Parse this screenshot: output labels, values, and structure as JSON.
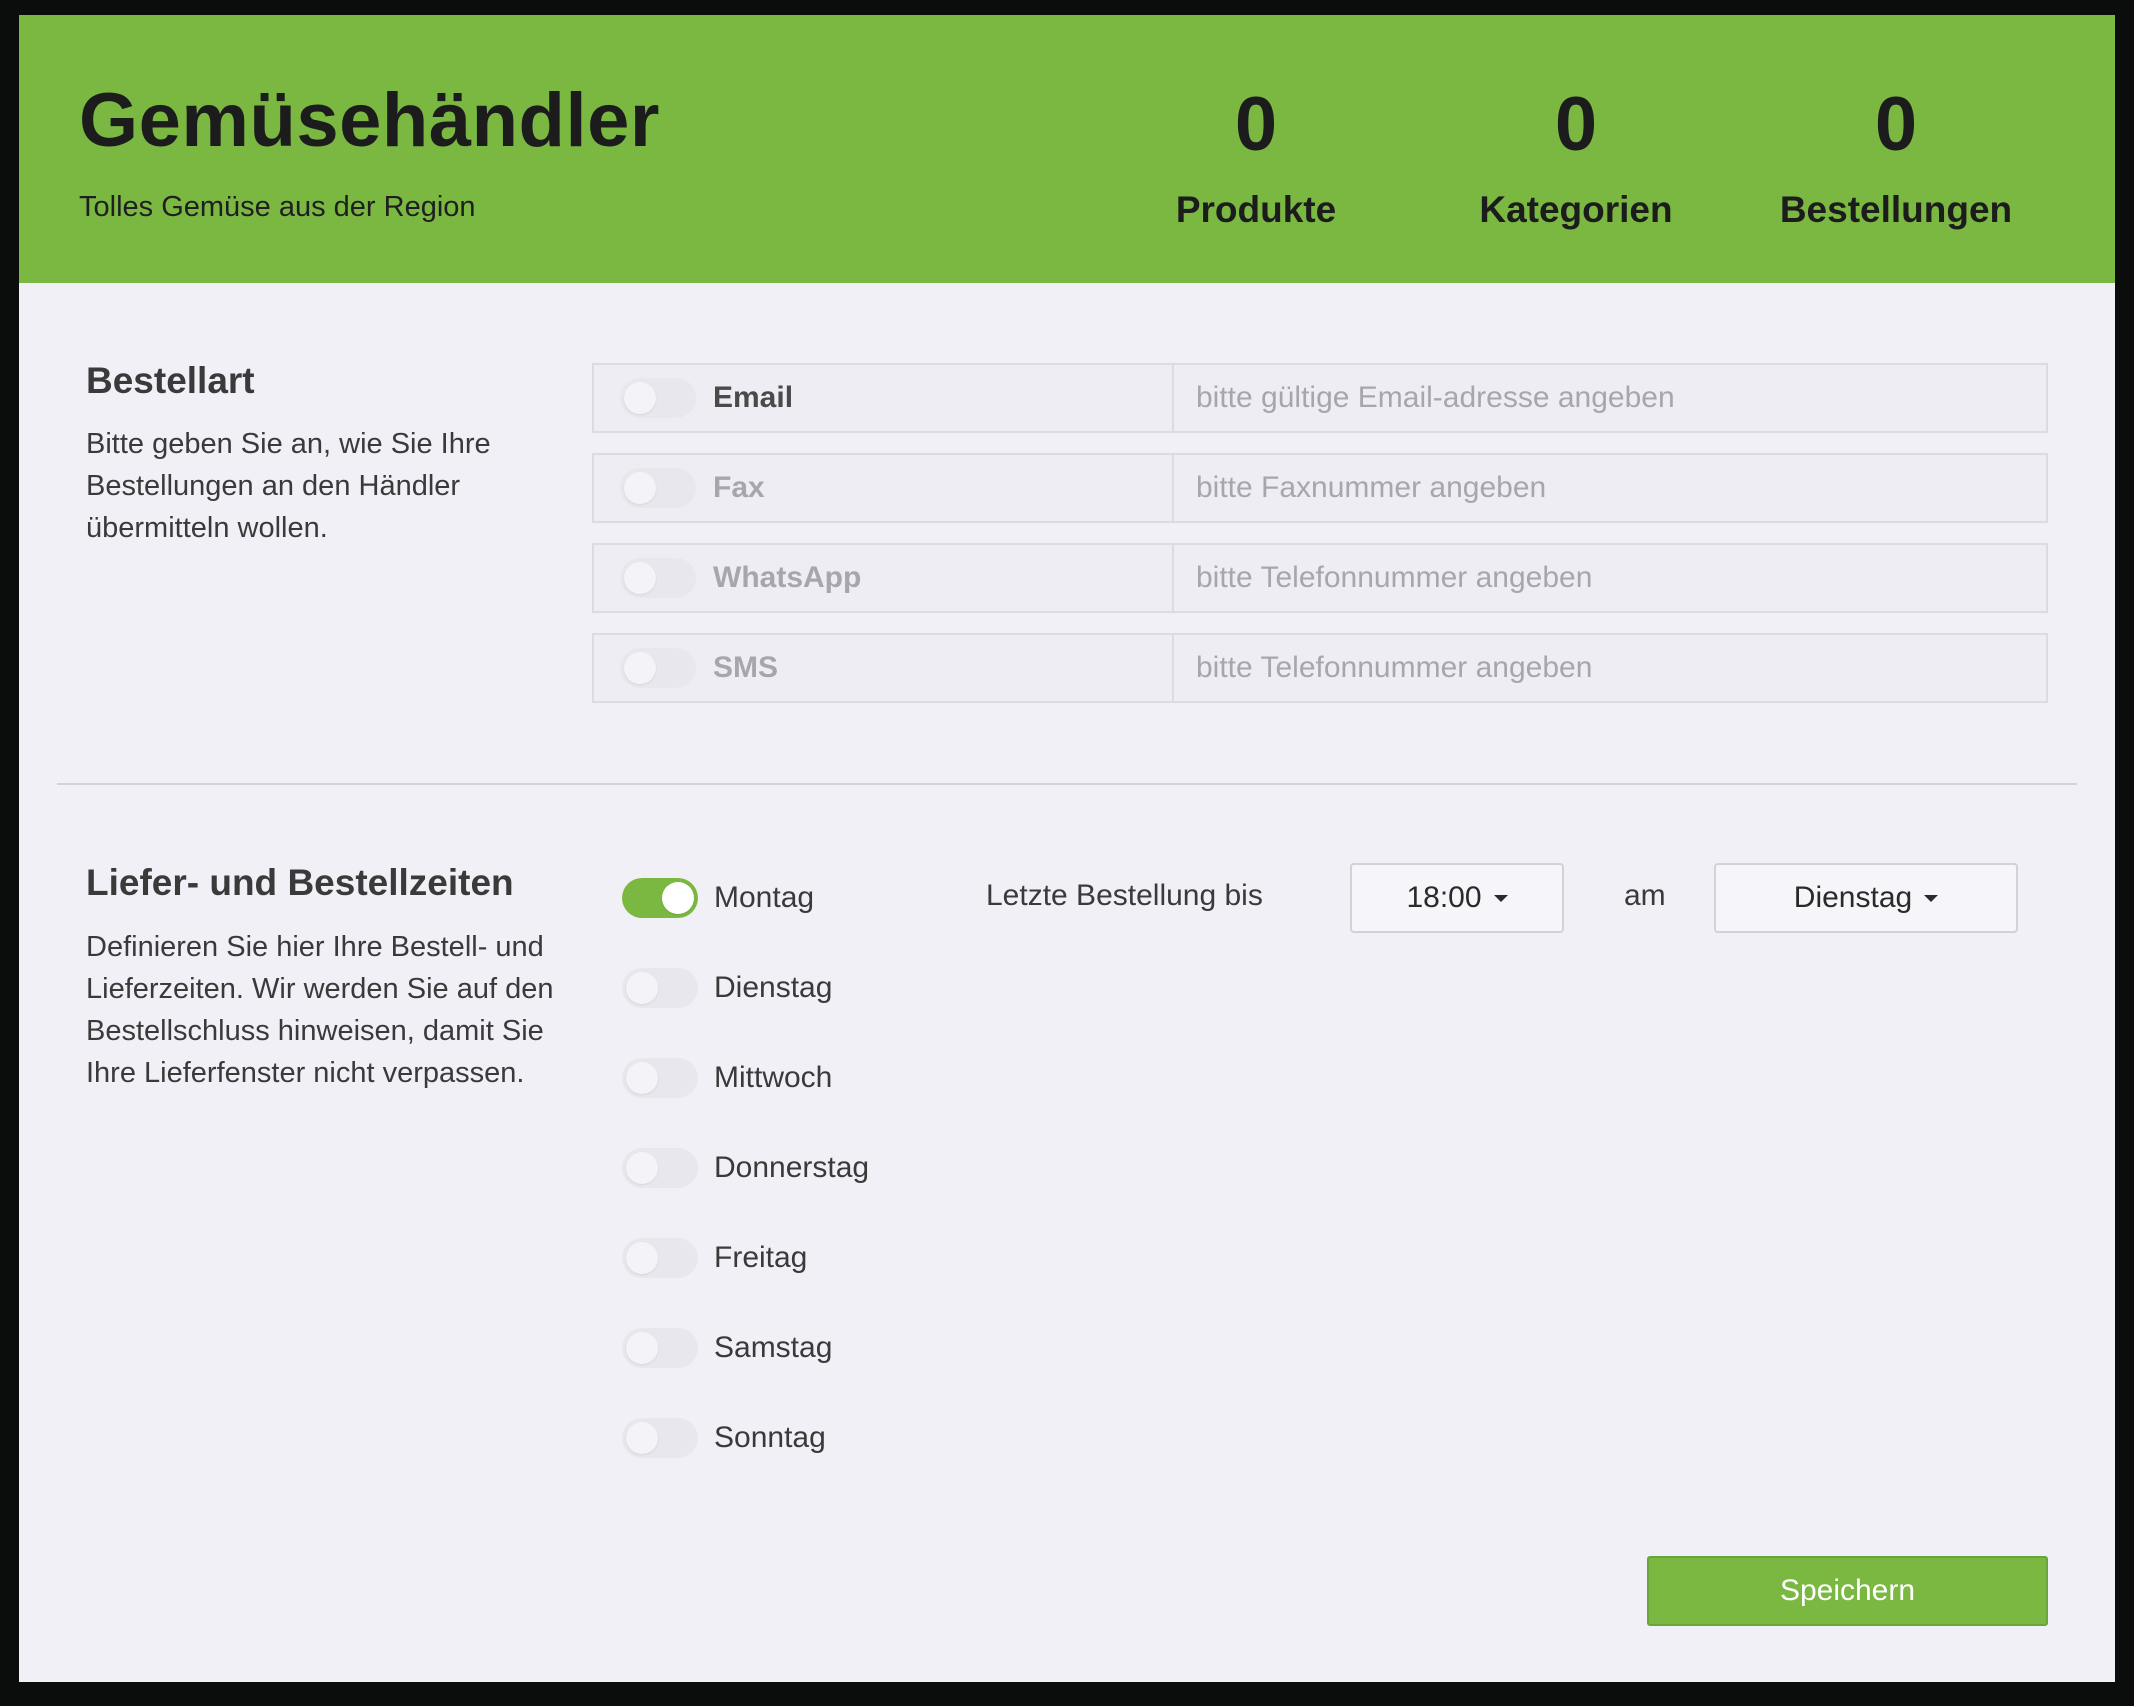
{
  "header": {
    "title": "Gemüsehändler",
    "subtitle": "Tolles Gemüse aus der Region",
    "stats": [
      {
        "value": "0",
        "label": "Produkte"
      },
      {
        "value": "0",
        "label": "Kategorien"
      },
      {
        "value": "0",
        "label": "Bestellungen"
      }
    ]
  },
  "order_type": {
    "title": "Bestellart",
    "description": "Bitte geben Sie an, wie Sie Ihre Bestellungen an den Händler übermitteln wollen.",
    "rows": [
      {
        "label": "Email",
        "placeholder": "bitte gültige Email-adresse angeben",
        "enabled": false
      },
      {
        "label": "Fax",
        "placeholder": "bitte Faxnummer angeben",
        "enabled": false
      },
      {
        "label": "WhatsApp",
        "placeholder": "bitte Telefonnummer angeben",
        "enabled": false
      },
      {
        "label": "SMS",
        "placeholder": "bitte Telefonnummer angeben",
        "enabled": false
      }
    ]
  },
  "times": {
    "title": "Liefer- und Bestellzeiten",
    "description": "Definieren Sie hier Ihre Bestell- und Lieferzeiten. Wir werden Sie auf den Bestellschluss hinweisen, damit Sie Ihre Lieferfenster nicht verpassen.",
    "days": [
      {
        "label": "Montag",
        "enabled": true
      },
      {
        "label": "Dienstag",
        "enabled": false
      },
      {
        "label": "Mittwoch",
        "enabled": false
      },
      {
        "label": "Donnerstag",
        "enabled": false
      },
      {
        "label": "Freitag",
        "enabled": false
      },
      {
        "label": "Samstag",
        "enabled": false
      },
      {
        "label": "Sonntag",
        "enabled": false
      }
    ],
    "last_order_label": "Letzte Bestellung bis",
    "time_value": "18:00",
    "am_label": "am",
    "day_value": "Dienstag"
  },
  "save_label": "Speichern",
  "colors": {
    "accent": "#7bb842",
    "background": "#f2f0f7"
  }
}
